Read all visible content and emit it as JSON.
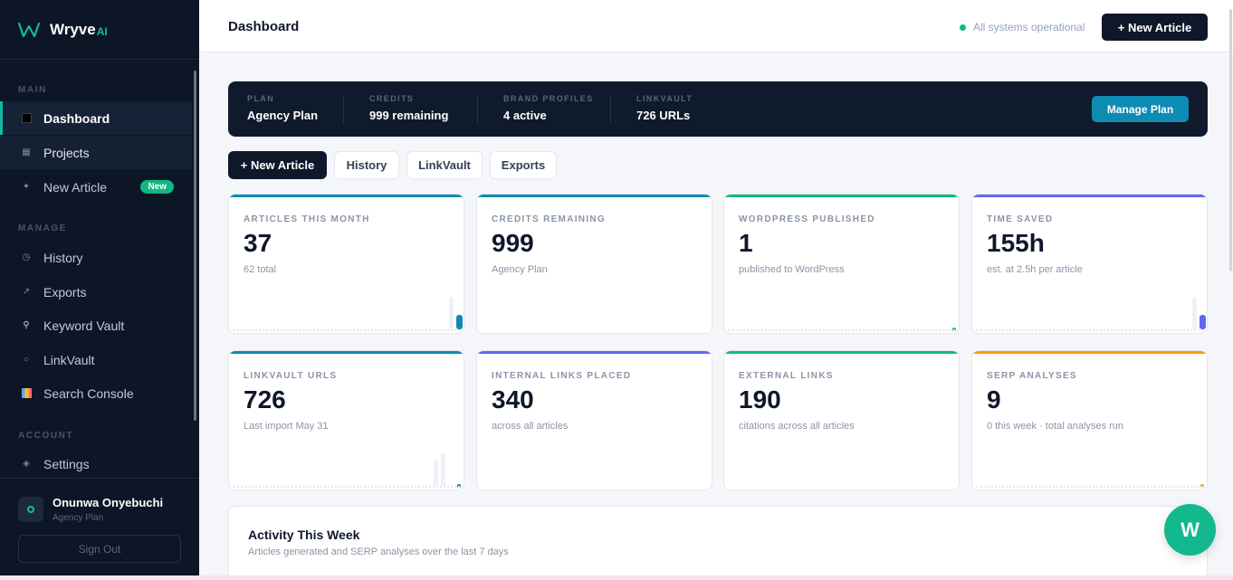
{
  "brand": {
    "name": "Wryve",
    "suffix": "AI"
  },
  "sidebar": {
    "sections": {
      "main": "MAIN",
      "manage": "MANAGE",
      "account": "ACCOUNT"
    },
    "items": [
      {
        "label": "Dashboard",
        "icon": "square-icon"
      },
      {
        "label": "Projects",
        "icon": "grid-icon"
      },
      {
        "label": "New Article",
        "icon": "sparkle-icon",
        "badge": "New"
      },
      {
        "label": "History",
        "icon": "clock-icon"
      },
      {
        "label": "Exports",
        "icon": "arrow-icon"
      },
      {
        "label": "Keyword Vault",
        "icon": "microscope-icon"
      },
      {
        "label": "LinkVault",
        "icon": "circle-icon"
      },
      {
        "label": "Search Console",
        "icon": "chart-icon"
      },
      {
        "label": "Settings",
        "icon": "gear-icon"
      }
    ],
    "user": {
      "name": "Onunwa Onyebuchi",
      "plan": "Agency Plan"
    },
    "sign_out": "Sign Out"
  },
  "header": {
    "title": "Dashboard",
    "status": "All systems operational",
    "new_article": "+ New Article"
  },
  "plan_bar": {
    "plan_label": "PLAN",
    "plan_value": "Agency Plan",
    "credits_label": "CREDITS",
    "credits_value": "999 remaining",
    "brand_label": "BRAND PROFILES",
    "brand_value": "4 active",
    "linkvault_label": "LINKVAULT",
    "linkvault_value": "726 URLs",
    "manage": "Manage Plan"
  },
  "actions": {
    "new_article": "+ New Article",
    "history": "History",
    "linkvault": "LinkVault",
    "exports": "Exports"
  },
  "stats": [
    {
      "label": "ARTICLES THIS MONTH",
      "value": "37",
      "sub": "62 total",
      "color": "#0e8bb2"
    },
    {
      "label": "CREDITS REMAINING",
      "value": "999",
      "sub": "Agency Plan",
      "color": "#0e8bb2"
    },
    {
      "label": "WORDPRESS PUBLISHED",
      "value": "1",
      "sub": "published to WordPress",
      "color": "#10b981"
    },
    {
      "label": "TIME SAVED",
      "value": "155h",
      "sub": "est. at 2.5h per article",
      "color": "#6366f1"
    },
    {
      "label": "LINKVAULT URLS",
      "value": "726",
      "sub": "Last import May 31",
      "color": "#0e8bb2"
    },
    {
      "label": "INTERNAL LINKS PLACED",
      "value": "340",
      "sub": "across all articles",
      "color": "#6366f1"
    },
    {
      "label": "EXTERNAL LINKS",
      "value": "190",
      "sub": "citations across all articles",
      "color": "#10b981"
    },
    {
      "label": "SERP ANALYSES",
      "value": "9",
      "sub": "0 this week · total analyses run",
      "color": "#f59e0b"
    }
  ],
  "activity": {
    "title": "Activity This Week",
    "subtitle": "Articles generated and SERP analyses over the last 7 days"
  },
  "fab": {
    "label": "W"
  }
}
